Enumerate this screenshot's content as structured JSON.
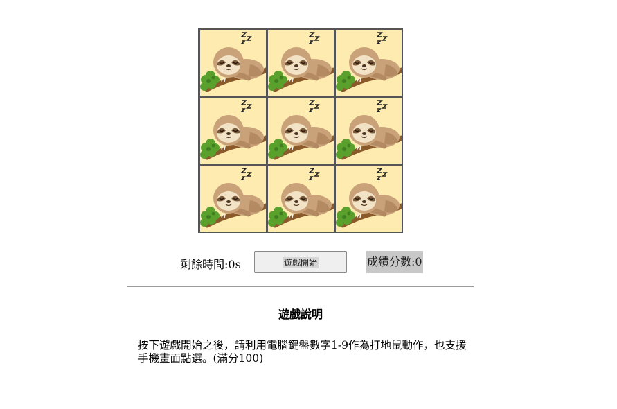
{
  "board": {
    "holes": [
      {
        "key": "1",
        "occupant": "sleeping-sloth-icon"
      },
      {
        "key": "2",
        "occupant": "sleeping-sloth-icon"
      },
      {
        "key": "3",
        "occupant": "sleeping-sloth-icon"
      },
      {
        "key": "4",
        "occupant": "sleeping-sloth-icon"
      },
      {
        "key": "5",
        "occupant": "sleeping-sloth-icon"
      },
      {
        "key": "6",
        "occupant": "sleeping-sloth-icon"
      },
      {
        "key": "7",
        "occupant": "sleeping-sloth-icon"
      },
      {
        "key": "8",
        "occupant": "sleeping-sloth-icon"
      },
      {
        "key": "9",
        "occupant": "sleeping-sloth-icon"
      }
    ],
    "colors": {
      "board_border": "#555555",
      "tile_bg": "#fdebb0"
    }
  },
  "controls": {
    "time_label": "剩餘時間:0s",
    "start_button_label": "遊戲開始",
    "score_label": "成績分數:0"
  },
  "instructions": {
    "title": "遊戲說明",
    "text": "按下遊戲開始之後，請利用電腦鍵盤數字1-9作為打地鼠動作，也支援手機畫面點選。(滿分100)"
  }
}
